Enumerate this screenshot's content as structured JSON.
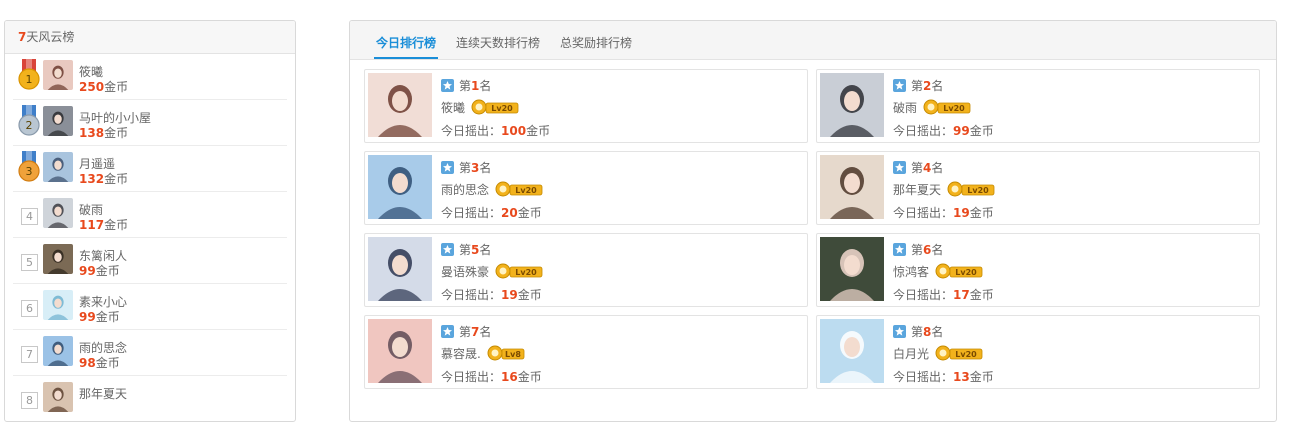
{
  "left": {
    "header_num": "7",
    "header_text": "天风云榜",
    "items": [
      {
        "rank": "1",
        "name": "筱曦",
        "coins": "250",
        "unit": "金币",
        "avatar_bg": "#e9c9c0",
        "avatar_fg": "#6b3a2e"
      },
      {
        "rank": "2",
        "name": "马叶的小小屋",
        "coins": "138",
        "unit": "金币",
        "avatar_bg": "#8a8f98",
        "avatar_fg": "#2a2b2e"
      },
      {
        "rank": "3",
        "name": "月遥遥",
        "coins": "132",
        "unit": "金币",
        "avatar_bg": "#a9c4de",
        "avatar_fg": "#3b4e6b"
      },
      {
        "rank": "4",
        "name": "破雨",
        "coins": "117",
        "unit": "金币",
        "avatar_bg": "#cfd4da",
        "avatar_fg": "#3a3a40"
      },
      {
        "rank": "5",
        "name": "东篱闲人",
        "coins": "99",
        "unit": "金币",
        "avatar_bg": "#7b6a55",
        "avatar_fg": "#2e261d"
      },
      {
        "rank": "6",
        "name": "素来小心",
        "coins": "99",
        "unit": "金币",
        "avatar_bg": "#d8eef7",
        "avatar_fg": "#6fb1cf"
      },
      {
        "rank": "7",
        "name": "雨的思念",
        "coins": "98",
        "unit": "金币",
        "avatar_bg": "#9bc2e6",
        "avatar_fg": "#2f4a6a"
      },
      {
        "rank": "8",
        "name": "那年夏天",
        "coins": "",
        "unit": "",
        "avatar_bg": "#d9c3b0",
        "avatar_fg": "#5a3f2e"
      }
    ]
  },
  "tabs": [
    "今日排行榜",
    "连续天数排行榜",
    "总奖励排行榜"
  ],
  "active_tab": 0,
  "cards": [
    {
      "prefix": "第",
      "rank": "1",
      "suffix": "名",
      "name": "筱曦",
      "level": "Lv20",
      "amount_label": "今日摇出：",
      "amount": "100",
      "unit": "金币",
      "avatar_bg": "#f1ddd6",
      "avatar_fg": "#6b3a2e"
    },
    {
      "prefix": "第",
      "rank": "2",
      "suffix": "名",
      "name": "破雨",
      "level": "Lv20",
      "amount_label": "今日摇出：",
      "amount": "99",
      "unit": "金币",
      "avatar_bg": "#c9ced6",
      "avatar_fg": "#2b2d33"
    },
    {
      "prefix": "第",
      "rank": "3",
      "suffix": "名",
      "name": "雨的思念",
      "level": "Lv20",
      "amount_label": "今日摇出：",
      "amount": "20",
      "unit": "金币",
      "avatar_bg": "#a8cbe9",
      "avatar_fg": "#2d4c70"
    },
    {
      "prefix": "第",
      "rank": "4",
      "suffix": "名",
      "name": "那年夏天",
      "level": "Lv20",
      "amount_label": "今日摇出：",
      "amount": "19",
      "unit": "金币",
      "avatar_bg": "#e6d9cc",
      "avatar_fg": "#4a3426"
    },
    {
      "prefix": "第",
      "rank": "5",
      "suffix": "名",
      "name": "曼语殊豪",
      "level": "Lv20",
      "amount_label": "今日摇出：",
      "amount": "19",
      "unit": "金币",
      "avatar_bg": "#d4dbe8",
      "avatar_fg": "#2b3550"
    },
    {
      "prefix": "第",
      "rank": "6",
      "suffix": "名",
      "name": "惊鸿客",
      "level": "Lv20",
      "amount_label": "今日摇出：",
      "amount": "17",
      "unit": "金币",
      "avatar_bg": "#3f4b3a",
      "avatar_fg": "#f2d8cf"
    },
    {
      "prefix": "第",
      "rank": "7",
      "suffix": "名",
      "name": "慕容晟.",
      "level": "Lv8",
      "amount_label": "今日摇出：",
      "amount": "16",
      "unit": "金币",
      "avatar_bg": "#f0c6c0",
      "avatar_fg": "#5e4a55"
    },
    {
      "prefix": "第",
      "rank": "8",
      "suffix": "名",
      "name": "白月光",
      "level": "Lv20",
      "amount_label": "今日摇出：",
      "amount": "13",
      "unit": "金币",
      "avatar_bg": "#bcdcf0",
      "avatar_fg": "#ffffff"
    }
  ],
  "colors": {
    "accent": "#1a8ed8",
    "highlight": "#e8491d",
    "gold": "#f2b21c",
    "silver": "#b9c6d2",
    "bronze": "#f0a23a",
    "ribbon_red": "#d9443a",
    "ribbon_blue": "#3f7fc9"
  }
}
